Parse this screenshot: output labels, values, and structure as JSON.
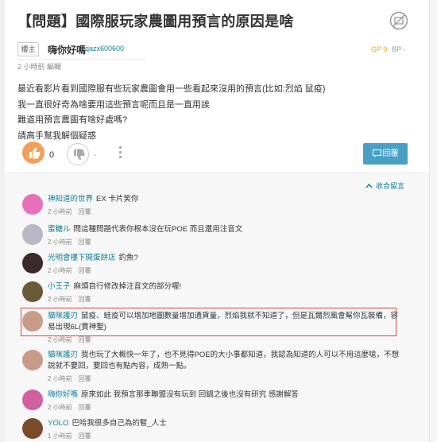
{
  "post": {
    "title": "【問題】國際服玩家農圖用預言的原因是啥",
    "tag": "樓主",
    "author_name": "嗨你好嗎",
    "author_id": "qazx600600",
    "gp": "GP 0",
    "bp": "BP -",
    "meta": "2 小時前 編輯",
    "body_lines": [
      "最近看影片看到國際服有些玩家農圖會用一些看起來沒用的預言(比如:烈焰 鼠疫)",
      "我一直很好奇為啥要用這些預言呢而且是一直用誒",
      "難道用預言農圖有啥好處嗎?",
      "請高手幫我解個疑惑"
    ],
    "like_count": "0",
    "dislike_label": "-",
    "reply_label": "回覆"
  },
  "comments_header": {
    "collapse_label": "收合留言"
  },
  "comments": [
    {
      "name": "神知道的世界",
      "text": "EX 卡片笑你",
      "time": "2 小時前",
      "action": "回覆",
      "avatar_color": "#e870b8"
    },
    {
      "name": "蜜糖ル",
      "text": "問這種問題代表你根本沒在玩POE 而且還用注音文",
      "time": "2 小時前",
      "action": "回覆",
      "avatar_color": "#b8b8c4"
    },
    {
      "name": "光明會樓下開蛋餅店",
      "text": "釣魚?",
      "time": "2 小時前",
      "action": "回覆",
      "avatar_color": "#3a2a2a"
    },
    {
      "name": "小王子",
      "text": "麻煩自行修改掉注音文的部分喔!",
      "time": "2 小時前",
      "action": "回覆",
      "avatar_color": "#6a5a3a"
    },
    {
      "name": "貓咪護刃",
      "text": "鼠疫、蛙疫可以增加地圖數量增加通貨量，烈焰我就不知道了，但是瓦爾烈風會幫你瓦裝備，容易出現6L(賣神聖)",
      "time": "2 小時前",
      "action": "回覆",
      "avatar_color": "#c89a88"
    },
    {
      "name": "貓咪護刃",
      "text": "我也玩了大概快一年了，也不見得POE的大小事都知道，我認為知道的人可以不用這麼嗆，不想說就不要回，要回也有點內容，成熟一點。",
      "time": "2 小時前",
      "action": "回覆",
      "avatar_color": "#c89a88"
    },
    {
      "name": "嗨你好嗎",
      "text": "原來如此 我預言那季聯盟沒有玩到 回鍋之後也沒有研究 感謝解答",
      "time": "2 小時前",
      "action": "回覆",
      "avatar_color": "#d060a0"
    },
    {
      "name": "YOLO",
      "text": "巴哈我很多自己為的暫_人士",
      "time": "1 小時前",
      "action": "回覆",
      "avatar_color": "#7a4a2a"
    }
  ],
  "colors": {
    "accent": "#117e96",
    "like": "#f0a05a",
    "reply_button": "#4a9fc6",
    "highlight_border": "#d9443f",
    "gp": "#e6a800"
  },
  "icons": [
    "no-icon",
    "thumb-up-icon",
    "thumb-down-icon",
    "more-vertical-icon",
    "reply-icon",
    "chevron-up-icon"
  ]
}
